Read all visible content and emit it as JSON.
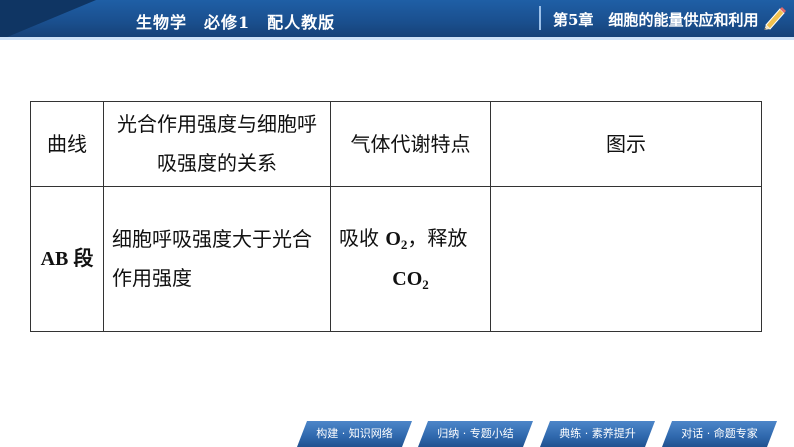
{
  "header": {
    "book": "生物学　必修1　配人教版",
    "chapter": "第5章　细胞的能量供应和利用",
    "pencil_icon": "pencil-icon",
    "color_primary": "#1a4f8e",
    "color_dark": "#0f3563"
  },
  "table": {
    "headers": [
      "曲线",
      "光合作用强度与细胞呼吸强度的关系",
      "气体代谢特点",
      "图示"
    ],
    "rows": [
      {
        "curve": "AB 段",
        "relation": "细胞呼吸强度大于光合作用强度",
        "gas_prefix": "吸收 ",
        "gas_o": "O",
        "gas_o_sub": "2",
        "gas_mid": "，释放",
        "gas_co": "CO",
        "gas_co_sub": "2",
        "figure": ""
      }
    ]
  },
  "nav": {
    "buttons": [
      "构建 · 知识网络",
      "归纳 · 专题小结",
      "典练 · 素养提升",
      "对话 · 命题专家"
    ]
  }
}
